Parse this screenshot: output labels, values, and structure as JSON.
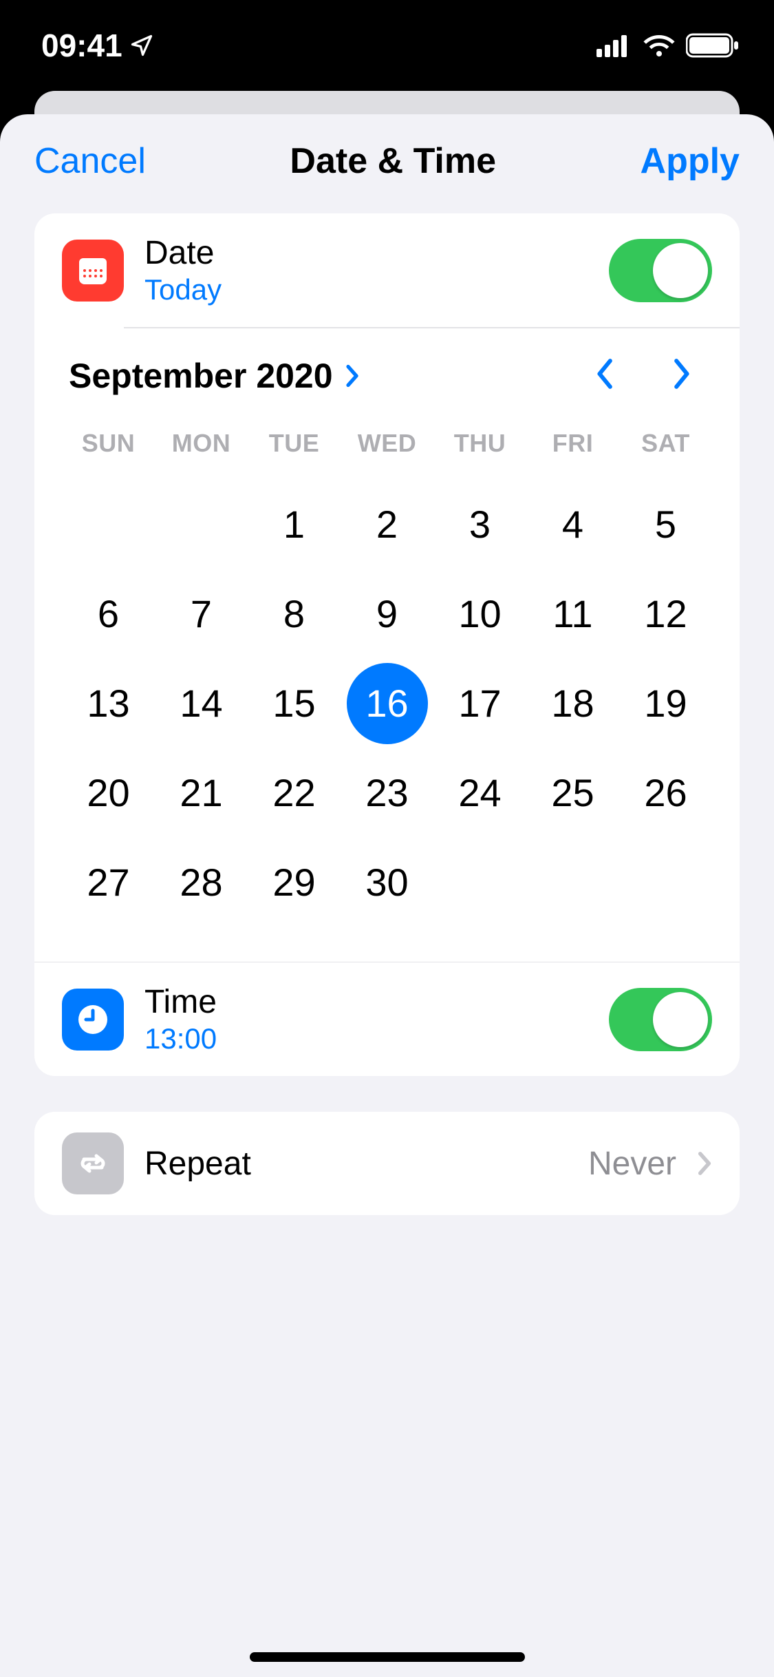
{
  "status": {
    "time": "09:41"
  },
  "nav": {
    "cancel": "Cancel",
    "title": "Date & Time",
    "apply": "Apply"
  },
  "date_row": {
    "label": "Date",
    "value": "Today"
  },
  "calendar": {
    "month_label": "September 2020",
    "weekdays": [
      "SUN",
      "MON",
      "TUE",
      "WED",
      "THU",
      "FRI",
      "SAT"
    ],
    "leading_blanks": 2,
    "days_in_month": 30,
    "selected_day": 16
  },
  "time_row": {
    "label": "Time",
    "value": "13:00"
  },
  "repeat_row": {
    "label": "Repeat",
    "value": "Never"
  }
}
